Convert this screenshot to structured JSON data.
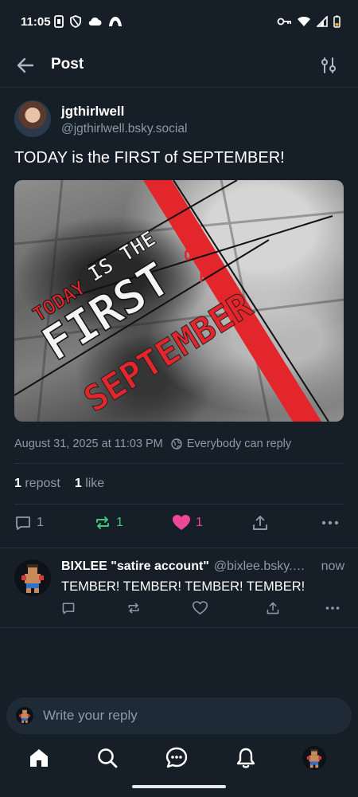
{
  "status_bar": {
    "time": "11:05"
  },
  "header": {
    "title": "Post"
  },
  "post": {
    "author_name": "jgthirlwell",
    "author_handle": "@jgthirlwell.bsky.social",
    "text": "TODAY is the FIRST of SEPTEMBER!",
    "image_text": {
      "today": "TODAY",
      "is_the": "IS THE",
      "first": "FIRST",
      "o": "O",
      "f": "F",
      "september": "SEPTEMBER"
    },
    "timestamp": "August 31, 2025 at 11:03 PM",
    "reply_setting": "Everybody can reply",
    "repost_count": "1",
    "repost_label": "repost",
    "like_count": "1",
    "like_label": "like",
    "actions": {
      "reply_count": "1",
      "repost_count": "1",
      "like_count": "1"
    }
  },
  "reply": {
    "author_name": "BIXLEE \"satire account\"",
    "author_handle": "@bixlee.bsky.social",
    "time": "now",
    "text": "TEMBER! TEMBER! TEMBER! TEMBER!"
  },
  "composer": {
    "placeholder": "Write your reply"
  },
  "colors": {
    "background": "#161e27",
    "repost_green": "#3fc97a",
    "like_pink": "#ec4899",
    "muted": "#8c9aaa",
    "image_red": "#e3262c"
  },
  "nav": [
    "home-icon",
    "search-icon",
    "chat-icon",
    "bell-icon",
    "profile-avatar"
  ]
}
